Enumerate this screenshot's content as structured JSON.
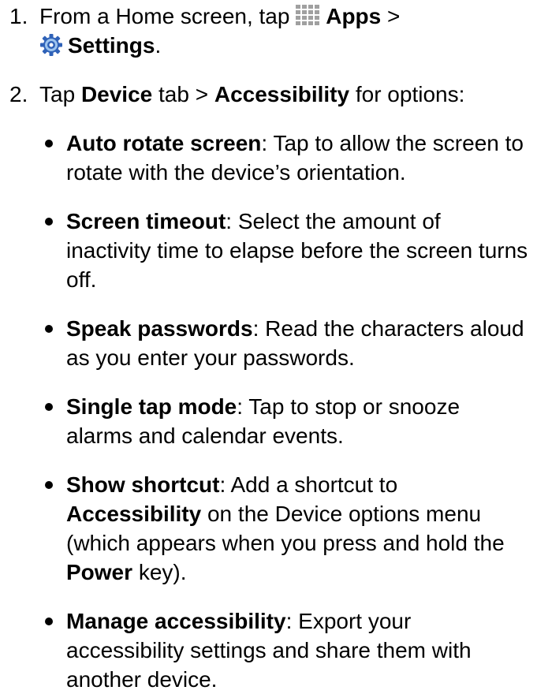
{
  "steps": [
    {
      "number": "1.",
      "text_prefix": "From a Home screen, tap",
      "apps_icon": "apps-grid-icon",
      "apps_label": "Apps",
      "separator": ">",
      "settings_icon": "settings-gear-icon",
      "settings_label": "Settings",
      "text_suffix": "."
    },
    {
      "number": "2.",
      "text_prefix": "Tap",
      "device_label": "Device",
      "text_middle": "tab >",
      "accessibility_label": "Accessibility",
      "text_suffix": "for options:"
    }
  ],
  "options": [
    {
      "title": "Auto rotate screen",
      "description": ": Tap to allow the screen to rotate with the device’s orientation."
    },
    {
      "title": "Screen timeout",
      "description": ": Select the amount of inactivity time to elapse before the screen turns off."
    },
    {
      "title": "Speak passwords",
      "description": ": Read the characters aloud as you enter your passwords."
    },
    {
      "title": "Single tap mode",
      "description": ": Tap to stop or snooze alarms and calendar events."
    },
    {
      "title": "Show shortcut",
      "description_part1": ": Add a shortcut to",
      "bold_accessibility": "Accessibility",
      "description_part2": "on the Device options menu (which appears when you press and hold the",
      "bold_power": "Power",
      "description_part3": "key)."
    },
    {
      "title": "Manage accessibility",
      "description": ": Export your accessibility settings and share them with another device."
    }
  ],
  "colors": {
    "text": "#000000",
    "apps_icon": "#a0a0a0",
    "settings_icon_blue": "#2f62b8",
    "settings_icon_light": "#9cc4ee"
  }
}
